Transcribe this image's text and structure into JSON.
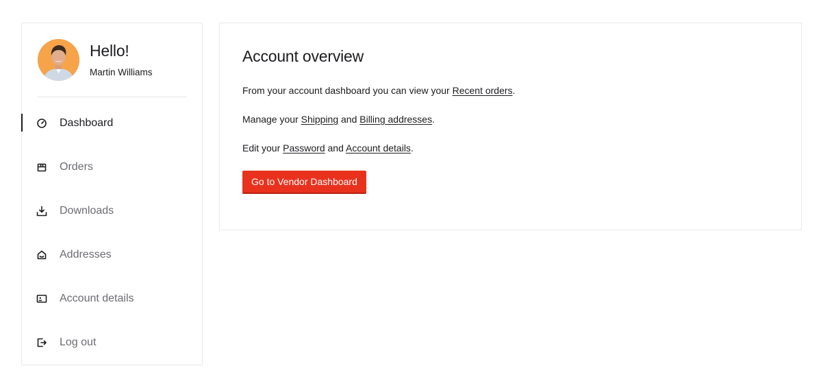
{
  "user": {
    "greeting": "Hello!",
    "name": "Martin Williams"
  },
  "nav": {
    "items": [
      {
        "label": "Dashboard",
        "icon": "dashboard-gauge-icon",
        "active": true
      },
      {
        "label": "Orders",
        "icon": "orders-box-icon",
        "active": false
      },
      {
        "label": "Downloads",
        "icon": "download-icon",
        "active": false
      },
      {
        "label": "Addresses",
        "icon": "home-address-icon",
        "active": false
      },
      {
        "label": "Account details",
        "icon": "id-card-icon",
        "active": false
      },
      {
        "label": "Log out",
        "icon": "logout-icon",
        "active": false
      }
    ]
  },
  "main": {
    "title": "Account overview",
    "p1": {
      "prefix": "From your account dashboard you can view your ",
      "link": "Recent orders",
      "suffix": "."
    },
    "p2": {
      "prefix": "Manage your ",
      "link1": "Shipping",
      "middle": " and ",
      "link2": "Billing addresses",
      "suffix": "."
    },
    "p3": {
      "prefix": "Edit your ",
      "link1": "Password",
      "middle": " and ",
      "link2": "Account details",
      "suffix": "."
    },
    "vendor_button": "Go to Vendor Dashboard"
  },
  "colors": {
    "accent": "#e8321e",
    "avatar_bg": "#f6a34a",
    "text_dark": "#1b1b1f",
    "text_muted": "#6b6b72",
    "border": "#e8e8e8"
  }
}
